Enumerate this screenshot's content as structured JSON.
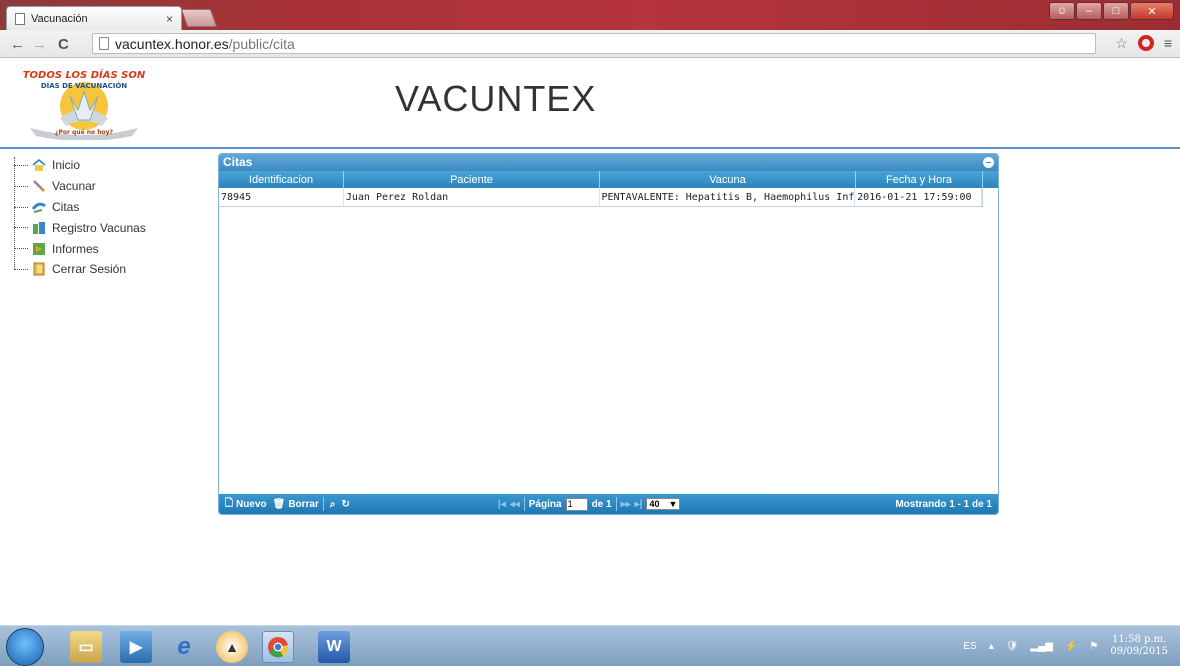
{
  "browser": {
    "tab_title": "Vacunación",
    "tab_close": "×",
    "url_host": "vacuntex.honor.es",
    "url_path": "/public/cita",
    "back": "←",
    "forward": "→",
    "reload": "C",
    "star": "☆",
    "menu": "≡"
  },
  "app": {
    "title": "VACUNTEX",
    "logo_text_top": "TODOS LOS DÍAS SON",
    "logo_text_mid": "DÍAS DE VACUNACIÓN",
    "logo_text_bottom": "¿Por qué no hoy?"
  },
  "sidebar": {
    "items": [
      {
        "label": "Inicio",
        "icon": "home-icon"
      },
      {
        "label": "Vacunar",
        "icon": "syringe-icon"
      },
      {
        "label": "Citas",
        "icon": "calendar-icon"
      },
      {
        "label": "Registro Vacunas",
        "icon": "register-icon"
      },
      {
        "label": "Informes",
        "icon": "report-icon"
      },
      {
        "label": "Cerrar Sesión",
        "icon": "logout-icon"
      }
    ]
  },
  "grid": {
    "title": "Citas",
    "columns": [
      "Identificacion",
      "Paciente",
      "Vacuna",
      "Fecha y Hora"
    ],
    "rows": [
      [
        "78945",
        "Juan  Perez Roldan",
        "PENTAVALENTE: Hepatitis B, Haemophilus Infuenza",
        "2016-01-21 17:59:00"
      ]
    ],
    "pager": {
      "new_label": "Nuevo",
      "delete_label": "Borrar",
      "page_label": "Página",
      "page_value": "1",
      "of_label": "de 1",
      "page_size": "40",
      "status": "Mostrando 1 - 1 de 1"
    }
  },
  "taskbar": {
    "lang": "ES",
    "time": "11:58 p.m.",
    "date": "09/09/2015"
  },
  "colors": {
    "accent": "#2c84bd",
    "header_line": "#5a91c9",
    "titlebar": "#a83236"
  }
}
